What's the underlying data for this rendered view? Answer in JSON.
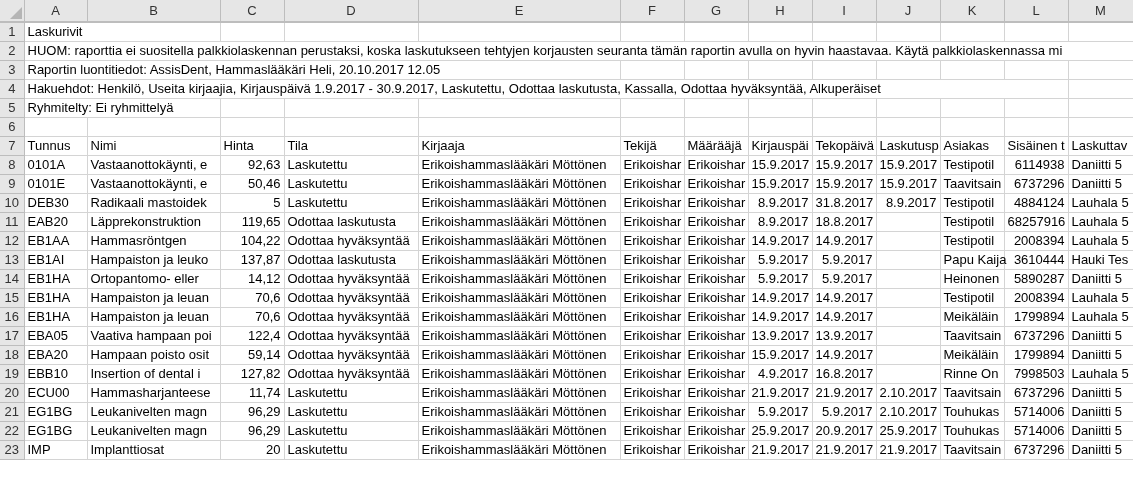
{
  "column_headers": [
    "A",
    "B",
    "C",
    "D",
    "E",
    "F",
    "G",
    "H",
    "I",
    "J",
    "K",
    "L",
    "M"
  ],
  "text_rows": [
    {
      "row": "1",
      "text": "Laskurivit"
    },
    {
      "row": "2",
      "text": "HUOM: raporttia ei suositella palkkiolaskennan perustaksi, koska laskutukseen tehtyjen korjausten seuranta tämän raportin avulla on hyvin haastavaa. Käytä palkkiolaskennassa mi"
    },
    {
      "row": "3",
      "text": "Raportin luontitiedot: AssisDent, Hammaslääkäri Heli, 20.10.2017 12.05"
    },
    {
      "row": "4",
      "text": "Hakuehdot:  Henkilö, Useita kirjaajia, Kirjauspäivä 1.9.2017 - 30.9.2017, Laskutettu, Odottaa laskutusta, Kassalla, Odottaa hyväksyntää, Alkuperäiset"
    },
    {
      "row": "5",
      "text": "Ryhmitelty: Ei ryhmittelyä"
    }
  ],
  "empty_row": "6",
  "header_row": {
    "row": "7",
    "cells": [
      "Tunnus",
      "Nimi",
      "Hinta",
      "Tila",
      "Kirjaaja",
      "Tekijä",
      "Määrääjä",
      "Kirjauspäi",
      "Tekopäivä",
      "Laskutusp",
      "Asiakas",
      "Sisäinen t",
      "Laskuttav"
    ]
  },
  "rows": [
    {
      "row": "8",
      "tunnus": "0101A",
      "nimi": "Vastaanottokäynti, e",
      "hinta": "92,63",
      "tila": "Laskutettu",
      "kirjaaja": "Erikoishammaslääkäri Möttönen",
      "tekija": "Erikoishar",
      "maaraaja": "Erikoishar",
      "kirjauspaiva": "15.9.2017",
      "tekopaiva": "15.9.2017",
      "laskutuspaiva": "15.9.2017",
      "asiakas": "Testipotil",
      "sisainen": "6114938",
      "laskuttava": "Daniitti 5"
    },
    {
      "row": "9",
      "tunnus": "0101E",
      "nimi": "Vastaanottokäynti, e",
      "hinta": "50,46",
      "tila": "Laskutettu",
      "kirjaaja": "Erikoishammaslääkäri Möttönen",
      "tekija": "Erikoishar",
      "maaraaja": "Erikoishar",
      "kirjauspaiva": "15.9.2017",
      "tekopaiva": "15.9.2017",
      "laskutuspaiva": "15.9.2017",
      "asiakas": "Taavitsain",
      "sisainen": "6737296",
      "laskuttava": "Daniitti 5"
    },
    {
      "row": "10",
      "tunnus": "DEB30",
      "nimi": "Radikaali mastoidek",
      "hinta": "5",
      "tila": "Laskutettu",
      "kirjaaja": "Erikoishammaslääkäri Möttönen",
      "tekija": "Erikoishar",
      "maaraaja": "Erikoishar",
      "kirjauspaiva": "8.9.2017",
      "tekopaiva": "31.8.2017",
      "laskutuspaiva": "8.9.2017",
      "asiakas": "Testipotil",
      "sisainen": "4884124",
      "laskuttava": "Lauhala 5"
    },
    {
      "row": "11",
      "tunnus": "EAB20",
      "nimi": "Läpprekonstruktion",
      "hinta": "119,65",
      "tila": "Odottaa laskutusta",
      "kirjaaja": "Erikoishammaslääkäri Möttönen",
      "tekija": "Erikoishar",
      "maaraaja": "Erikoishar",
      "kirjauspaiva": "8.9.2017",
      "tekopaiva": "18.8.2017",
      "asiakas": "Testipotil",
      "sisainen": "68257916",
      "laskuttava": "Lauhala 5"
    },
    {
      "row": "12",
      "tunnus": "EB1AA",
      "nimi": "Hammasröntgen",
      "hinta": "104,22",
      "tila": "Odottaa hyväksyntää",
      "kirjaaja": "Erikoishammaslääkäri Möttönen",
      "tekija": "Erikoishar",
      "maaraaja": "Erikoishar",
      "kirjauspaiva": "14.9.2017",
      "tekopaiva": "14.9.2017",
      "asiakas": "Testipotil",
      "sisainen": "2008394",
      "laskuttava": "Lauhala 5"
    },
    {
      "row": "13",
      "tunnus": "EB1AI",
      "nimi": "Hampaiston ja leuko",
      "hinta": "137,87",
      "tila": "Odottaa laskutusta",
      "kirjaaja": "Erikoishammaslääkäri Möttönen",
      "tekija": "Erikoishar",
      "maaraaja": "Erikoishar",
      "kirjauspaiva": "5.9.2017",
      "tekopaiva": "5.9.2017",
      "asiakas": "Papu Kaija",
      "sisainen": "3610444",
      "laskuttava": "Hauki Tes"
    },
    {
      "row": "14",
      "tunnus": "EB1HA",
      "nimi": "Ortopantomo- eller",
      "hinta": "14,12",
      "tila": "Odottaa hyväksyntää",
      "kirjaaja": "Erikoishammaslääkäri Möttönen",
      "tekija": "Erikoishar",
      "maaraaja": "Erikoishar",
      "kirjauspaiva": "5.9.2017",
      "tekopaiva": "5.9.2017",
      "asiakas": "Heinonen",
      "sisainen": "5890287",
      "laskuttava": "Daniitti 5"
    },
    {
      "row": "15",
      "tunnus": "EB1HA",
      "nimi": "Hampaiston ja leuan",
      "hinta": "70,6",
      "tila": "Odottaa hyväksyntää",
      "kirjaaja": "Erikoishammaslääkäri Möttönen",
      "tekija": "Erikoishar",
      "maaraaja": "Erikoishar",
      "kirjauspaiva": "14.9.2017",
      "tekopaiva": "14.9.2017",
      "asiakas": "Testipotil",
      "sisainen": "2008394",
      "laskuttava": "Lauhala 5"
    },
    {
      "row": "16",
      "tunnus": "EB1HA",
      "nimi": "Hampaiston ja leuan",
      "hinta": "70,6",
      "tila": "Odottaa hyväksyntää",
      "kirjaaja": "Erikoishammaslääkäri Möttönen",
      "tekija": "Erikoishar",
      "maaraaja": "Erikoishar",
      "kirjauspaiva": "14.9.2017",
      "tekopaiva": "14.9.2017",
      "asiakas": "Meikäläin",
      "sisainen": "1799894",
      "laskuttava": "Lauhala 5"
    },
    {
      "row": "17",
      "tunnus": "EBA05",
      "nimi": "Vaativa hampaan poi",
      "hinta": "122,4",
      "tila": "Odottaa hyväksyntää",
      "kirjaaja": "Erikoishammaslääkäri Möttönen",
      "tekija": "Erikoishar",
      "maaraaja": "Erikoishar",
      "kirjauspaiva": "13.9.2017",
      "tekopaiva": "13.9.2017",
      "asiakas": "Taavitsain",
      "sisainen": "6737296",
      "laskuttava": "Daniitti 5"
    },
    {
      "row": "18",
      "tunnus": "EBA20",
      "nimi": "Hampaan poisto osit",
      "hinta": "59,14",
      "tila": "Odottaa hyväksyntää",
      "kirjaaja": "Erikoishammaslääkäri Möttönen",
      "tekija": "Erikoishar",
      "maaraaja": "Erikoishar",
      "kirjauspaiva": "15.9.2017",
      "tekopaiva": "14.9.2017",
      "asiakas": "Meikäläin",
      "sisainen": "1799894",
      "laskuttava": "Daniitti 5"
    },
    {
      "row": "19",
      "tunnus": "EBB10",
      "nimi": "Insertion of dental i",
      "hinta": "127,82",
      "tila": "Odottaa hyväksyntää",
      "kirjaaja": "Erikoishammaslääkäri Möttönen",
      "tekija": "Erikoishar",
      "maaraaja": "Erikoishar",
      "kirjauspaiva": "4.9.2017",
      "tekopaiva": "16.8.2017",
      "asiakas": "Rinne On",
      "sisainen": "7998503",
      "laskuttava": "Lauhala 5"
    },
    {
      "row": "20",
      "tunnus": "ECU00",
      "nimi": "Hammasharjanteese",
      "hinta": "11,74",
      "tila": "Laskutettu",
      "kirjaaja": "Erikoishammaslääkäri Möttönen",
      "tekija": "Erikoishar",
      "maaraaja": "Erikoishar",
      "kirjauspaiva": "21.9.2017",
      "tekopaiva": "21.9.2017",
      "laskutuspaiva": "2.10.2017",
      "asiakas": "Taavitsain",
      "sisainen": "6737296",
      "laskuttava": "Daniitti 5"
    },
    {
      "row": "21",
      "tunnus": "EG1BG",
      "nimi": "Leukanivelten magn",
      "hinta": "96,29",
      "tila": "Laskutettu",
      "kirjaaja": "Erikoishammaslääkäri Möttönen",
      "tekija": "Erikoishar",
      "maaraaja": "Erikoishar",
      "kirjauspaiva": "5.9.2017",
      "tekopaiva": "5.9.2017",
      "laskutuspaiva": "2.10.2017",
      "asiakas": "Touhukas",
      "sisainen": "5714006",
      "laskuttava": "Daniitti 5"
    },
    {
      "row": "22",
      "tunnus": "EG1BG",
      "nimi": "Leukanivelten magn",
      "hinta": "96,29",
      "tila": "Laskutettu",
      "kirjaaja": "Erikoishammaslääkäri Möttönen",
      "tekija": "Erikoishar",
      "maaraaja": "Erikoishar",
      "kirjauspaiva": "25.9.2017",
      "tekopaiva": "20.9.2017",
      "laskutuspaiva": "25.9.2017",
      "asiakas": "Touhukas",
      "sisainen": "5714006",
      "laskuttava": "Daniitti 5"
    },
    {
      "row": "23",
      "tunnus": "IMP",
      "nimi": "Implanttiosat",
      "hinta": "20",
      "tila": "Laskutettu",
      "kirjaaja": "Erikoishammaslääkäri Möttönen",
      "tekija": "Erikoishar",
      "maaraaja": "Erikoishar",
      "kirjauspaiva": "21.9.2017",
      "tekopaiva": "21.9.2017",
      "laskutuspaiva": "21.9.2017",
      "asiakas": "Taavitsain",
      "sisainen": "6737296",
      "laskuttava": "Daniitti 5"
    }
  ]
}
